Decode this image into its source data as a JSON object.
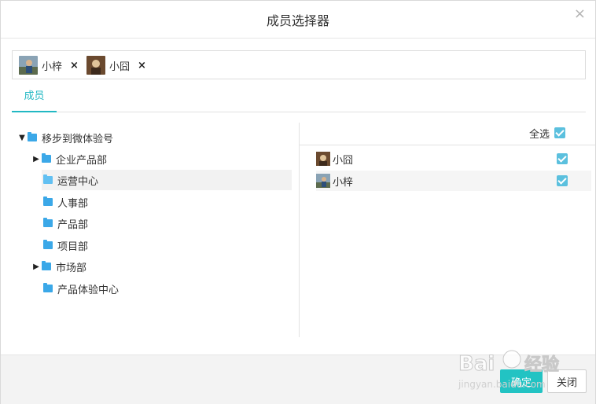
{
  "dialog": {
    "title": "成员选择器",
    "close_glyph": "×"
  },
  "selected_chips": [
    {
      "name": "小梓",
      "remove": "×"
    },
    {
      "name": "小囧",
      "remove": "×"
    }
  ],
  "tabs": [
    {
      "label": "成员"
    }
  ],
  "tree": {
    "root": {
      "label": "移步到微体验号",
      "expanded": true
    },
    "children": [
      {
        "label": "企业产品部",
        "has_children": true
      },
      {
        "label": "运营中心",
        "has_children": false,
        "highlighted": true
      },
      {
        "label": "人事部",
        "has_children": false
      },
      {
        "label": "产品部",
        "has_children": false
      },
      {
        "label": "项目部",
        "has_children": false
      },
      {
        "label": "市场部",
        "has_children": true
      },
      {
        "label": "产品体验中心",
        "has_children": false
      }
    ]
  },
  "members": {
    "select_all_label": "全选",
    "select_all_checked": true,
    "items": [
      {
        "name": "小囧",
        "checked": true
      },
      {
        "name": "小梓",
        "checked": true
      }
    ]
  },
  "footer": {
    "ok_label": "确定",
    "close_label": "关闭"
  },
  "colors": {
    "accent": "#22b8c3",
    "checkbox": "#5bc0de",
    "folder": "#3ba8e8"
  }
}
